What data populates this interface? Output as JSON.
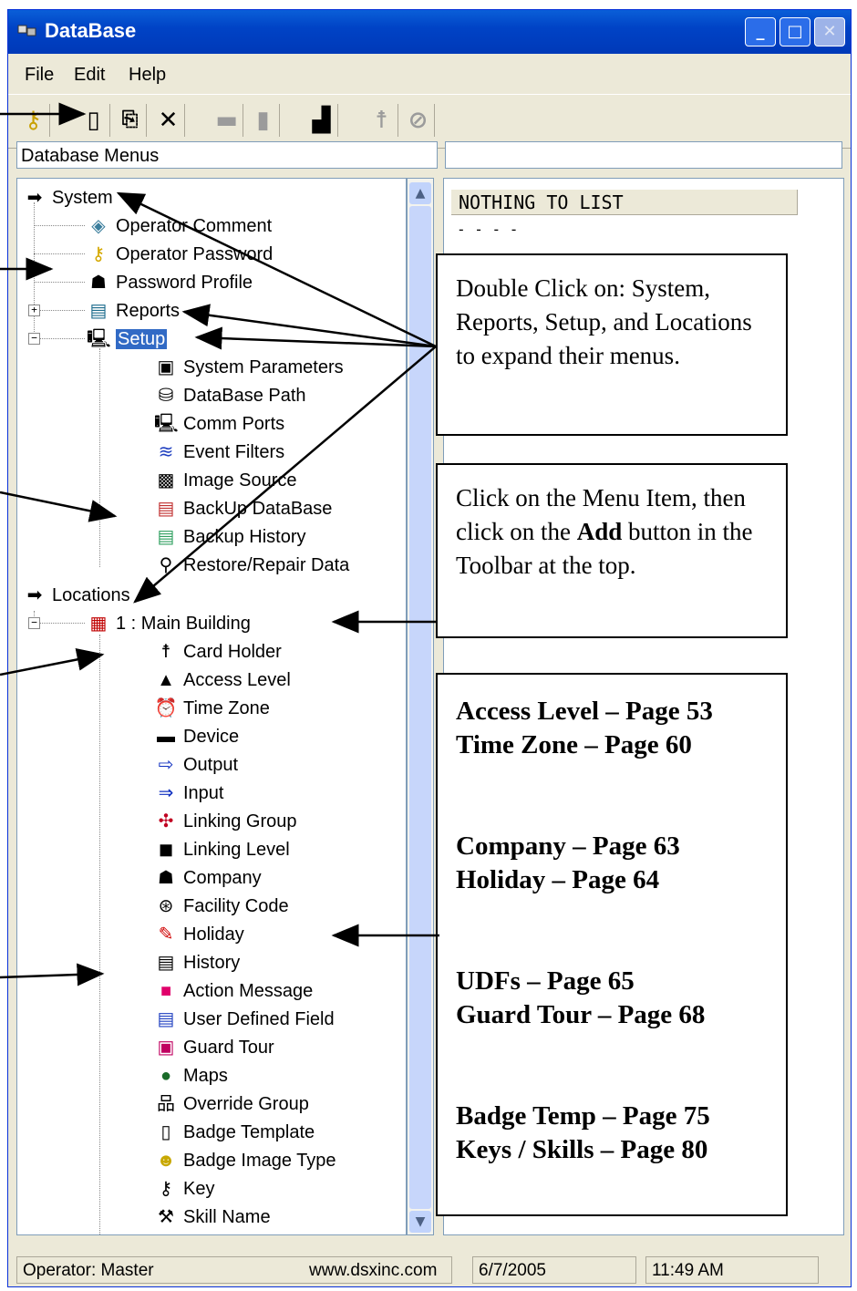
{
  "window": {
    "title": "DataBase"
  },
  "menu": {
    "file": "File",
    "edit": "Edit",
    "help": "Help"
  },
  "left_header": "Database Menus",
  "tree": {
    "system": "System",
    "system_items": [
      "Operator Comment",
      "Operator Password",
      "Password Profile",
      "Reports",
      "Setup"
    ],
    "setup_items": [
      "System Parameters",
      "DataBase Path",
      "Comm Ports",
      "Event Filters",
      "Image Source",
      "BackUp DataBase",
      "Backup History",
      "Restore/Repair Data"
    ],
    "locations": "Locations",
    "building": "1 : Main Building",
    "building_items": [
      "Card Holder",
      "Access Level",
      "Time Zone",
      "Device",
      "Output",
      "Input",
      "Linking Group",
      "Linking Level",
      "Company",
      "Facility Code",
      "Holiday",
      "History",
      "Action Message",
      "User Defined Field",
      "Guard Tour",
      "Maps",
      "Override Group",
      "Badge Template",
      "Badge Image Type",
      "Key",
      "Skill Name"
    ]
  },
  "list": {
    "column": "NOTHING TO LIST",
    "row": "- - - -"
  },
  "status": {
    "operator": "Operator:  Master",
    "website": "www.dsxinc.com",
    "date": "6/7/2005",
    "time": "11:49 AM"
  },
  "callouts": {
    "expand": "Double Click on: System, Reports, Setup, and Locations to expand their menus.",
    "add_1": "Click on the Menu Item, then click on the ",
    "add_bold": "Add",
    "add_2": " button in the Toolbar at the top.",
    "pages": [
      "Access Level – Page 53",
      "Time Zone – Page 60",
      "Company – Page 63",
      "Holiday – Page 64",
      "UDFs – Page 65",
      "Guard Tour – Page 68",
      "Badge Temp – Page 75",
      "Keys / Skills – Page 80"
    ]
  }
}
